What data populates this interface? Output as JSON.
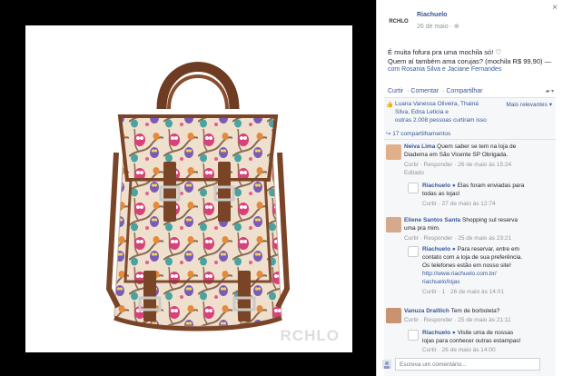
{
  "photo": {
    "watermark": "RCHLO"
  },
  "post": {
    "close_icon": "×",
    "page_logo": "RCHLO",
    "page_name": "Riachuelo",
    "date": "26 de maio · ",
    "text_lines": [
      "É muita fofura pra uma mochila só! ♡",
      "Quem aí também ama corujas? (mochila R$ 99,90) —"
    ],
    "with_line": "com Rosania Silva e Jaciane Fernandes",
    "actions": [
      "Curtir",
      "Comentar",
      "Compartilhar"
    ],
    "likes_text_lines": [
      "Luana Vanessa Oliveira, Thainá",
      "Silva, Edna Leticia e",
      "outras 2.008 pessoas curtiram isso"
    ],
    "sort_label": "Mais relevantes ▾",
    "shares_label": "17 compartilhamentos"
  },
  "comments": [
    {
      "author": "Neiva Lima",
      "text_lines": [
        "Quem saber se tem na loja de",
        "Diadema em São Vicente SP Obrigada."
      ],
      "meta": "Curtir · Responder · 26 de maio às 15:24",
      "edited": "Editado",
      "reply": {
        "author": "Riachuelo",
        "text_lines": [
          "Elas foram enviadas para",
          "todas as lojas!"
        ],
        "meta": "Curtir · 27 de maio às 12:74"
      }
    },
    {
      "author": "Eliene Santos Santa",
      "text_lines": [
        "Shopping sul reserva",
        "uma pra mim."
      ],
      "meta": "Curtir · Responder · 25 de maio às 23:21",
      "reply": {
        "author": "Riachuelo",
        "text_lines": [
          "Para reservar, entre em",
          "contato com a loja de sua preferência.",
          "Os telefones estão em nosso site!",
          "http://www.riachuelo.com.br/",
          "riachuelo/lojas"
        ],
        "meta": "Curtir · 1 · 26 de maio às 14:01"
      }
    },
    {
      "author": "Vanuza Dralllich",
      "text_lines": [
        "Tem de borboleta?"
      ],
      "meta": "Curtir · Responder · 25 de maio às 21:11",
      "reply": {
        "author": "Riachuelo",
        "text_lines": [
          "Visite uma de nossas",
          "lojas para conhecer outras estampas!"
        ],
        "meta": "Curtir · 26 de maio às 14:00"
      }
    }
  ],
  "composer": {
    "placeholder": "Escreva um comentário..."
  },
  "colors": {
    "link": "#365899",
    "bag_body": "#efe0cd",
    "leather": "#7a4427"
  }
}
